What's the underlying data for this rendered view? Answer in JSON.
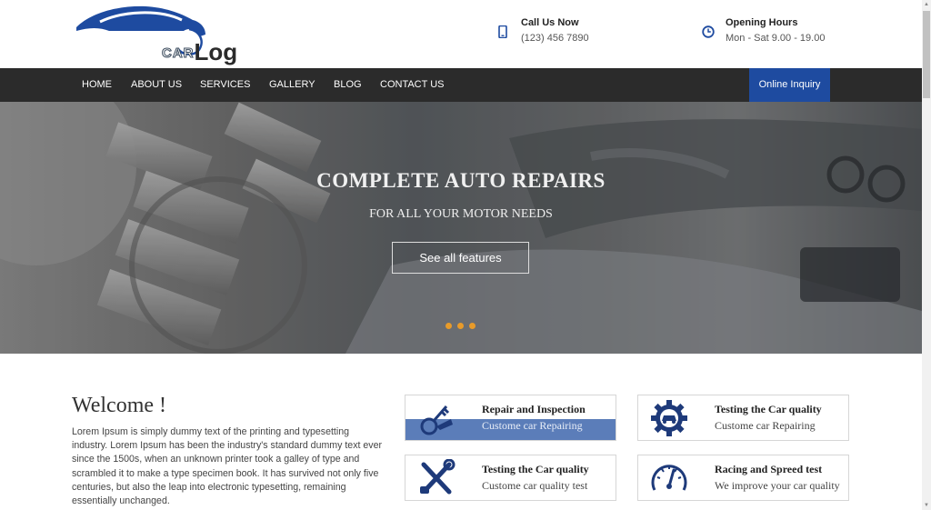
{
  "brand": {
    "logo_car": "CAR",
    "logo_log": "Log"
  },
  "contact": {
    "call": {
      "title": "Call Us Now",
      "value": "(123) 456 7890",
      "icon": "phone-icon"
    },
    "hours": {
      "title": "Opening Hours",
      "value": "Mon - Sat 9.00 - 19.00",
      "icon": "clock-icon"
    }
  },
  "nav": {
    "items": [
      {
        "label": "HOME"
      },
      {
        "label": "ABOUT US"
      },
      {
        "label": "SERVICES"
      },
      {
        "label": "GALLERY"
      },
      {
        "label": "BLOG"
      },
      {
        "label": "CONTACT US"
      }
    ],
    "cta": "Online Inquiry"
  },
  "hero": {
    "title": "COMPLETE AUTO REPAIRS",
    "subtitle": "FOR ALL YOUR MOTOR NEEDS",
    "button": "See all features",
    "slide_count": 3
  },
  "welcome": {
    "title": "Welcome !",
    "body": "Lorem Ipsum is simply dummy text of the printing and typesetting industry. Lorem Ipsum has been the industry's standard dummy text ever since the 1500s, when an unknown printer took a galley of type and scrambled it to make a type specimen book. It has survived not only five centuries, but also the leap into electronic typesetting, remaining essentially unchanged."
  },
  "services": [
    {
      "title": "Repair and Inspection",
      "subtitle": "Custome car Repairing",
      "icon": "keys-icon",
      "active": true
    },
    {
      "title": "Testing the Car quality",
      "subtitle": "Custome car Repairing",
      "icon": "gear-car-icon",
      "active": false
    },
    {
      "title": "Testing the Car quality",
      "subtitle": "Custome car quality test",
      "icon": "tools-icon",
      "active": false
    },
    {
      "title": "Racing and Spreed test",
      "subtitle": "We improve your car quality",
      "icon": "speedometer-icon",
      "active": false
    }
  ],
  "colors": {
    "nav_bg": "#2b2b2b",
    "accent": "#1e4ba0",
    "card_highlight": "#5b7db9",
    "slider_dot": "#e89b2a"
  }
}
